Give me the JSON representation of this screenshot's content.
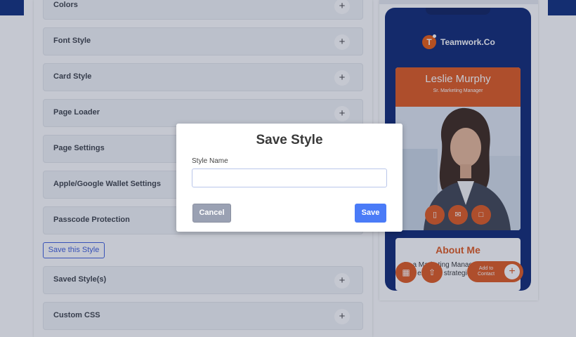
{
  "editor": {
    "sections": [
      {
        "label": "Colors"
      },
      {
        "label": "Font Style"
      },
      {
        "label": "Card Style"
      },
      {
        "label": "Page Loader"
      },
      {
        "label": "Page Settings"
      },
      {
        "label": "Apple/Google Wallet Settings"
      },
      {
        "label": "Passcode Protection"
      }
    ],
    "save_this_style_label": "Save this Style",
    "sections_after": [
      {
        "label": "Saved Style(s)"
      },
      {
        "label": "Custom CSS"
      }
    ],
    "plus_glyph": "+"
  },
  "preview": {
    "logo_letter": "T",
    "logo_text": "Teamwork.Co",
    "card_name": "Leslie Murphy",
    "card_title": "Sr. Marketing Manager",
    "about_title": "About Me",
    "about_text": "As a Marketing Manager, my focus is to execute strategies that elevate",
    "add_to_contact_label": "Add to Contact",
    "accent_color": "#e0571b",
    "phone_bg": "#0b2472"
  },
  "modal": {
    "title": "Save Style",
    "field_label": "Style Name",
    "field_value": "",
    "cancel_label": "Cancel",
    "save_label": "Save"
  },
  "colors": {
    "primary_button": "#4a7bf7",
    "cancel_button": "#9aa1b3"
  }
}
